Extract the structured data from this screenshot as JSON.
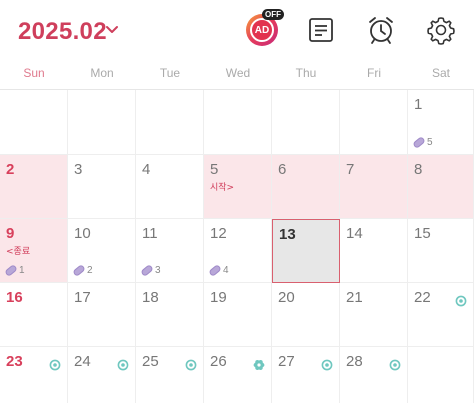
{
  "header": {
    "month_title": "2025.02",
    "ad_text": "AD",
    "ad_off_text": "OFF"
  },
  "weekdays": [
    "Sun",
    "Mon",
    "Tue",
    "Wed",
    "Thu",
    "Fri",
    "Sat"
  ],
  "weeks": [
    [
      {
        "day": ""
      },
      {
        "day": ""
      },
      {
        "day": ""
      },
      {
        "day": ""
      },
      {
        "day": ""
      },
      {
        "day": ""
      },
      {
        "day": "1",
        "pill": "5"
      }
    ],
    [
      {
        "day": "2",
        "range": true
      },
      {
        "day": "3"
      },
      {
        "day": "4"
      },
      {
        "day": "5",
        "range": true,
        "label": "시작>"
      },
      {
        "day": "6",
        "range": true
      },
      {
        "day": "7",
        "range": true
      },
      {
        "day": "8",
        "range": true
      }
    ],
    [
      {
        "day": "9",
        "range": true,
        "label": "<종료",
        "pill": "1"
      },
      {
        "day": "10",
        "pill": "2"
      },
      {
        "day": "11",
        "pill": "3"
      },
      {
        "day": "12",
        "pill": "4"
      },
      {
        "day": "13",
        "today": true
      },
      {
        "day": "14"
      },
      {
        "day": "15"
      }
    ],
    [
      {
        "day": "16"
      },
      {
        "day": "17"
      },
      {
        "day": "18"
      },
      {
        "day": "19"
      },
      {
        "day": "20"
      },
      {
        "day": "21"
      },
      {
        "day": "22",
        "mark": "ring"
      }
    ],
    [
      {
        "day": "23",
        "mark": "ring"
      },
      {
        "day": "24",
        "mark": "ring"
      },
      {
        "day": "25",
        "mark": "ring"
      },
      {
        "day": "26",
        "mark": "flower"
      },
      {
        "day": "27",
        "mark": "ring"
      },
      {
        "day": "28",
        "mark": "ring"
      },
      {
        "day": ""
      }
    ]
  ],
  "colors": {
    "accent": "#cf3f5c",
    "range_bg": "#fbe6e9",
    "today_bg": "#e7e7e7",
    "mark": "#6fc7bf",
    "pill": "#b8a7d8"
  },
  "icons": {
    "ad": "ad-off-badge-icon",
    "memo": "memo-list-icon",
    "alarm": "alarm-clock-icon",
    "settings": "gear-icon",
    "pill": "pill-icon",
    "ring": "ovulation-ring-icon",
    "flower": "flower-icon"
  }
}
